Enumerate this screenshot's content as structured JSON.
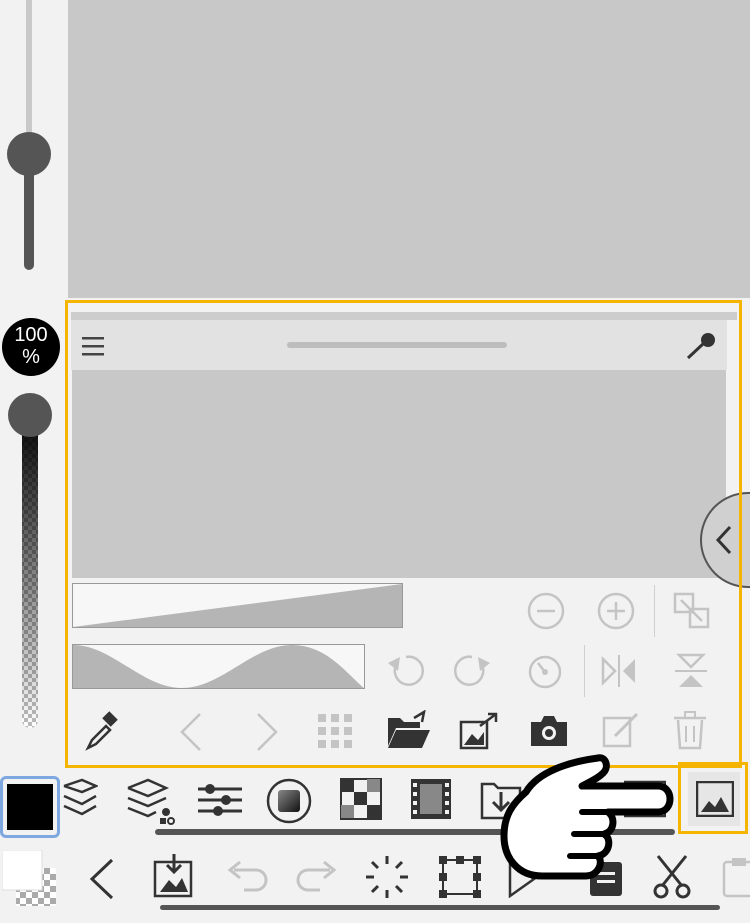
{
  "zoom": {
    "value": "100",
    "unit": "%"
  },
  "left_sliders": {
    "brush_size_level": 0.55,
    "opacity_level": 1.0
  },
  "navigator": {
    "menu_icon": "hamburger-icon",
    "pen_icon": "pen-icon",
    "row1": [
      "zoom-out-icon",
      "zoom-in-icon",
      "fit-screen-icon"
    ],
    "row2": [
      "rotate-left-icon",
      "rotate-right-icon",
      "reset-rotation-icon",
      "flip-horizontal-icon",
      "flip-vertical-icon"
    ],
    "row3": [
      "eyedropper-icon",
      "previous-icon",
      "next-icon",
      "grid-icon",
      "open-folder-icon",
      "export-image-icon",
      "camera-icon",
      "edit-icon",
      "trash-icon"
    ]
  },
  "palette_bar": [
    "layers-icon",
    "layer-properties-icon",
    "adjust-icon",
    "material-icon",
    "tone-icon",
    "filmstrip-icon",
    "download-icon",
    "frame-icon",
    "navigator-icon"
  ],
  "bottom_bar": [
    "back-icon",
    "import-icon",
    "undo-icon",
    "redo-icon",
    "loading-icon",
    "transform-icon",
    "play-icon",
    "clipboard-icon",
    "cut-icon",
    "paste-icon"
  ],
  "colors": {
    "accent_outline": "#f5b400",
    "selected_color": "#000000",
    "selection_blue": "#7fa8e0"
  }
}
